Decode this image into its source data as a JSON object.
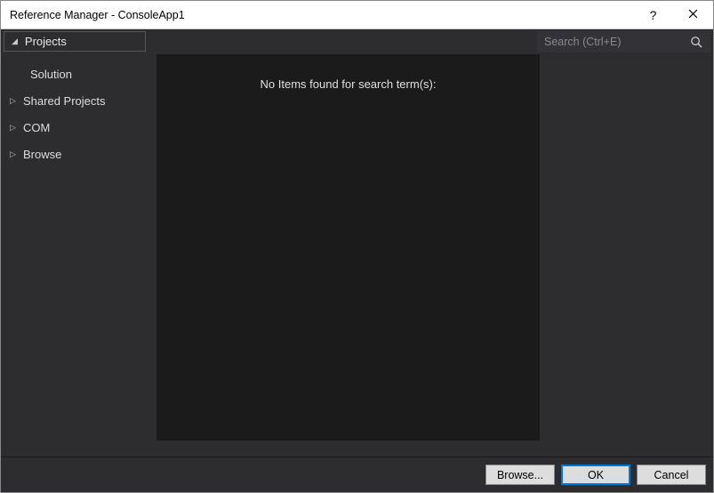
{
  "titlebar": {
    "title": "Reference Manager - ConsoleApp1",
    "help": "?",
    "close": "×"
  },
  "toprow": {
    "active_category": "Projects"
  },
  "search": {
    "placeholder": "Search (Ctrl+E)",
    "value": ""
  },
  "sidebar": {
    "items": [
      {
        "label": "Solution",
        "expandable": false
      },
      {
        "label": "Shared Projects",
        "expandable": true
      },
      {
        "label": "COM",
        "expandable": true
      },
      {
        "label": "Browse",
        "expandable": true
      }
    ]
  },
  "content": {
    "empty_message": "No Items found for search term(s):"
  },
  "footer": {
    "browse": "Browse...",
    "ok": "OK",
    "cancel": "Cancel"
  }
}
